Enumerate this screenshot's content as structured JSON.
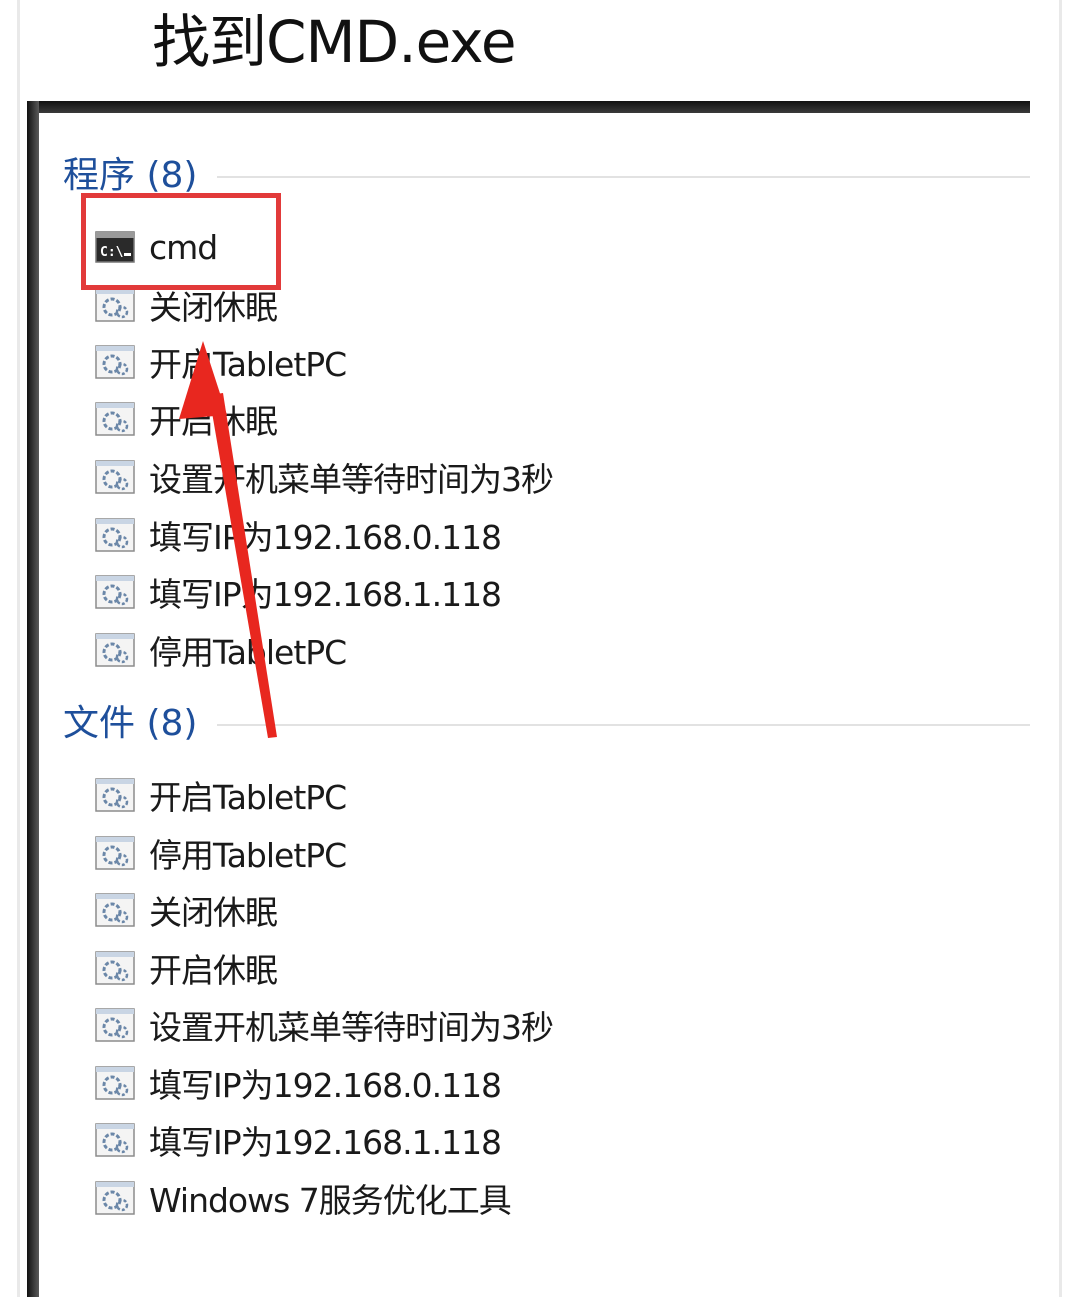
{
  "caption": "找到CMD.exe",
  "programs": {
    "title": "程序 (8)",
    "items": [
      {
        "label": "cmd",
        "icon": "cmd-console-icon"
      },
      {
        "label": "关闭休眠",
        "icon": "script-file-icon"
      },
      {
        "label": "开启TabletPC",
        "icon": "script-file-icon"
      },
      {
        "label": "开启休眠",
        "icon": "script-file-icon"
      },
      {
        "label": "设置开机菜单等待时间为3秒",
        "icon": "script-file-icon"
      },
      {
        "label": "填写IP为192.168.0.118",
        "icon": "script-file-icon"
      },
      {
        "label": "填写IP为192.168.1.118",
        "icon": "script-file-icon"
      },
      {
        "label": "停用TabletPC",
        "icon": "script-file-icon"
      }
    ]
  },
  "files": {
    "title": "文件 (8)",
    "items": [
      {
        "label": "开启TabletPC",
        "icon": "script-file-icon"
      },
      {
        "label": "停用TabletPC",
        "icon": "script-file-icon"
      },
      {
        "label": "关闭休眠",
        "icon": "script-file-icon"
      },
      {
        "label": "开启休眠",
        "icon": "script-file-icon"
      },
      {
        "label": "设置开机菜单等待时间为3秒",
        "icon": "script-file-icon"
      },
      {
        "label": "填写IP为192.168.0.118",
        "icon": "script-file-icon"
      },
      {
        "label": "填写IP为192.168.1.118",
        "icon": "script-file-icon"
      },
      {
        "label": "Windows 7服务优化工具",
        "icon": "script-file-icon"
      }
    ]
  },
  "annotation": {
    "highlight_color": "#e23a3a",
    "arrow_color": "#e8271f"
  },
  "colors": {
    "section_title": "#1e4f9b"
  }
}
